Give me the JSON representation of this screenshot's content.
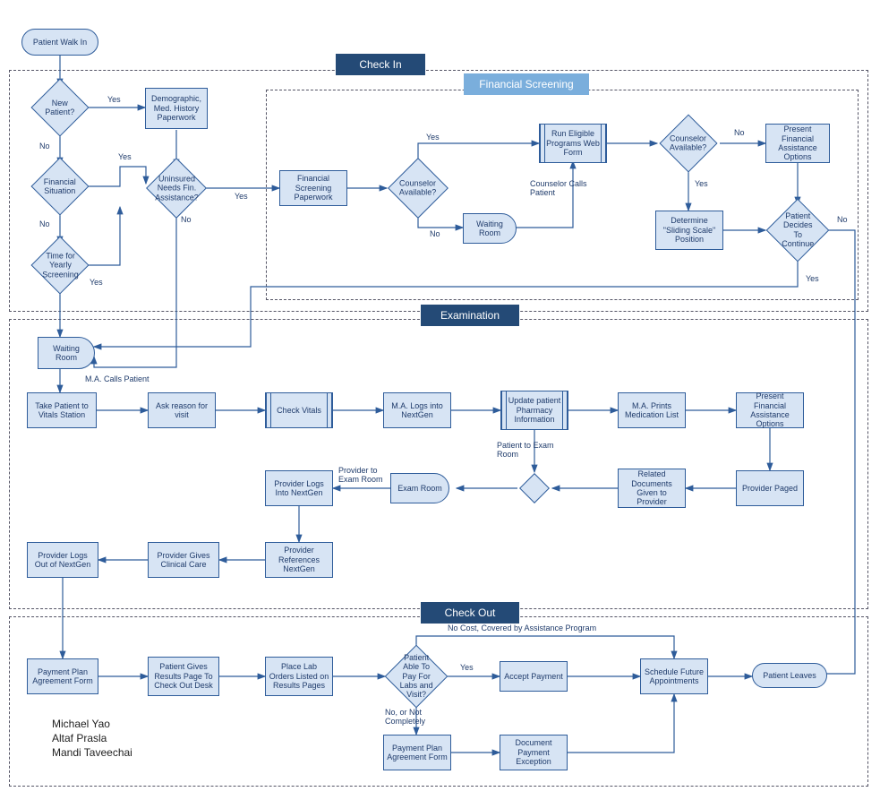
{
  "sections": {
    "checkin": "Check In",
    "financial": "Financial Screening",
    "exam": "Examination",
    "checkout": "Check Out"
  },
  "nodes": {
    "walkin": "Patient Walk In",
    "newPatient": "New Patient?",
    "demographic": "Demographic, Med. History Paperwork",
    "finSituation": "Financial Situation",
    "uninsured": "Uninsured Needs Fin. Assistance?",
    "timeYearly": "Time for Yearly Screening",
    "finScreenPaper": "Financial Screening Paperwork",
    "counselor1": "Counselor Available?",
    "waitingRoom1": "Waiting Room",
    "runEligible": "Run Eligible Programs Web Form",
    "counselor2": "Counselor Available?",
    "determineSliding": "Determine \"Sliding Scale\" Position",
    "presentFinOpts": "Present Financial Assistance Options",
    "patientDecides": "Patient Decides To Continue",
    "waitingRoom2": "Waiting Room",
    "takeVitals": "Take Patient to Vitals Station",
    "askReason": "Ask reason for visit",
    "checkVitals": "Check Vitals",
    "maLogs": "M.A. Logs into NextGen",
    "updatePharm": "Update patient Pharmacy Information",
    "maPrints": "M.A. Prints Medication List",
    "presentFin2": "Present Financial Assistance Options",
    "providerPaged": "Provider Paged",
    "relatedDocs": "Related Documents Given to Provider",
    "examRoomDiamond": "",
    "examRoomDelay": "Exam Room",
    "providerLogsIn": "Provider Logs Into NextGen",
    "providerRefs": "Provider References NextGen",
    "providerGives": "Provider Gives Clinical Care",
    "providerLogsOut": "Provider Logs Out of NextGen",
    "paymentPlan1": "Payment Plan Agreement Form",
    "patientGivesResults": "Patient Gives Results Page To Check Out Desk",
    "placeLabOrders": "Place Lab Orders Listed on Results Pages",
    "patientAblePay": "Patient Able To Pay For Labs and Visit?",
    "acceptPayment": "Accept Payment",
    "scheduleFuture": "Schedule Future Appointments",
    "patientLeaves": "Patient Leaves",
    "paymentPlan2": "Payment Plan Agreement Form",
    "docPaymentExc": "Document Payment Exception"
  },
  "labels": {
    "yes": "Yes",
    "no": "No",
    "counselorCalls": "Counselor Calls Patient",
    "maCalls": "M.A. Calls Patient",
    "patientToExam": "Patient to Exam Room",
    "providerToExam": "Provider to Exam Room",
    "noCost": "No Cost, Covered by Assistance Program",
    "noOrNot": "No, or Not Completely"
  },
  "authors": [
    "Michael Yao",
    "Altaf Prasla",
    "Mandi Taveechai"
  ],
  "chart_data": {
    "type": "flowchart",
    "title": "Patient Visit Workflow",
    "lanes": [
      "Check In",
      "Financial Screening",
      "Examination",
      "Check Out"
    ],
    "nodes": [
      {
        "id": "walkin",
        "type": "terminator",
        "label": "Patient Walk In",
        "lane": "Check In"
      },
      {
        "id": "newPatient",
        "type": "decision",
        "label": "New Patient?",
        "lane": "Check In"
      },
      {
        "id": "demographic",
        "type": "process",
        "label": "Demographic, Med. History Paperwork",
        "lane": "Check In"
      },
      {
        "id": "finSituation",
        "type": "decision",
        "label": "Financial Situation",
        "lane": "Check In"
      },
      {
        "id": "uninsured",
        "type": "decision",
        "label": "Uninsured Needs Fin. Assistance?",
        "lane": "Check In"
      },
      {
        "id": "timeYearly",
        "type": "decision",
        "label": "Time for Yearly Screening",
        "lane": "Check In"
      },
      {
        "id": "finScreenPaper",
        "type": "process",
        "label": "Financial Screening Paperwork",
        "lane": "Financial Screening"
      },
      {
        "id": "counselor1",
        "type": "decision",
        "label": "Counselor Available?",
        "lane": "Financial Screening"
      },
      {
        "id": "waitingRoom1",
        "type": "delay",
        "label": "Waiting Room",
        "lane": "Financial Screening"
      },
      {
        "id": "runEligible",
        "type": "predefined",
        "label": "Run Eligible Programs Web Form",
        "lane": "Financial Screening"
      },
      {
        "id": "counselor2",
        "type": "decision",
        "label": "Counselor Available?",
        "lane": "Financial Screening"
      },
      {
        "id": "determineSliding",
        "type": "process",
        "label": "Determine \"Sliding Scale\" Position",
        "lane": "Financial Screening"
      },
      {
        "id": "presentFinOpts",
        "type": "process",
        "label": "Present Financial Assistance Options",
        "lane": "Financial Screening"
      },
      {
        "id": "patientDecides",
        "type": "decision",
        "label": "Patient Decides To Continue",
        "lane": "Financial Screening"
      },
      {
        "id": "waitingRoom2",
        "type": "delay",
        "label": "Waiting Room",
        "lane": "Examination"
      },
      {
        "id": "takeVitals",
        "type": "process",
        "label": "Take Patient to Vitals Station",
        "lane": "Examination"
      },
      {
        "id": "askReason",
        "type": "process",
        "label": "Ask reason for visit",
        "lane": "Examination"
      },
      {
        "id": "checkVitals",
        "type": "predefined",
        "label": "Check Vitals",
        "lane": "Examination"
      },
      {
        "id": "maLogs",
        "type": "process",
        "label": "M.A. Logs into NextGen",
        "lane": "Examination"
      },
      {
        "id": "updatePharm",
        "type": "predefined",
        "label": "Update patient Pharmacy Information",
        "lane": "Examination"
      },
      {
        "id": "maPrints",
        "type": "process",
        "label": "M.A. Prints Medication List",
        "lane": "Examination"
      },
      {
        "id": "presentFin2",
        "type": "process",
        "label": "Present Financial Assistance Options",
        "lane": "Examination"
      },
      {
        "id": "providerPaged",
        "type": "process",
        "label": "Provider Paged",
        "lane": "Examination"
      },
      {
        "id": "relatedDocs",
        "type": "process",
        "label": "Related Documents Given to Provider",
        "lane": "Examination"
      },
      {
        "id": "examRoomDiamond",
        "type": "decision",
        "label": "",
        "lane": "Examination"
      },
      {
        "id": "examRoomDelay",
        "type": "delay",
        "label": "Exam Room",
        "lane": "Examination"
      },
      {
        "id": "providerLogsIn",
        "type": "process",
        "label": "Provider Logs Into NextGen",
        "lane": "Examination"
      },
      {
        "id": "providerRefs",
        "type": "process",
        "label": "Provider References NextGen",
        "lane": "Examination"
      },
      {
        "id": "providerGives",
        "type": "process",
        "label": "Provider Gives Clinical Care",
        "lane": "Examination"
      },
      {
        "id": "providerLogsOut",
        "type": "process",
        "label": "Provider Logs Out of NextGen",
        "lane": "Examination"
      },
      {
        "id": "paymentPlan1",
        "type": "process",
        "label": "Payment Plan Agreement Form",
        "lane": "Check Out"
      },
      {
        "id": "patientGivesResults",
        "type": "process",
        "label": "Patient Gives Results Page To Check Out Desk",
        "lane": "Check Out"
      },
      {
        "id": "placeLabOrders",
        "type": "process",
        "label": "Place Lab Orders Listed on Results Pages",
        "lane": "Check Out"
      },
      {
        "id": "patientAblePay",
        "type": "decision",
        "label": "Patient Able To Pay For Labs and Visit?",
        "lane": "Check Out"
      },
      {
        "id": "acceptPayment",
        "type": "process",
        "label": "Accept Payment",
        "lane": "Check Out"
      },
      {
        "id": "scheduleFuture",
        "type": "process",
        "label": "Schedule Future Appointments",
        "lane": "Check Out"
      },
      {
        "id": "patientLeaves",
        "type": "terminator",
        "label": "Patient Leaves",
        "lane": "Check Out"
      },
      {
        "id": "paymentPlan2",
        "type": "process",
        "label": "Payment Plan Agreement Form",
        "lane": "Check Out"
      },
      {
        "id": "docPaymentExc",
        "type": "process",
        "label": "Document Payment Exception",
        "lane": "Check Out"
      }
    ],
    "edges": [
      {
        "from": "walkin",
        "to": "newPatient"
      },
      {
        "from": "newPatient",
        "to": "demographic",
        "label": "Yes"
      },
      {
        "from": "newPatient",
        "to": "finSituation",
        "label": "No"
      },
      {
        "from": "demographic",
        "to": "uninsured"
      },
      {
        "from": "finSituation",
        "to": "uninsured",
        "label": "Yes"
      },
      {
        "from": "finSituation",
        "to": "timeYearly",
        "label": "No"
      },
      {
        "from": "timeYearly",
        "to": "uninsured",
        "label": "Yes"
      },
      {
        "from": "timeYearly",
        "to": "waitingRoom2"
      },
      {
        "from": "uninsured",
        "to": "finScreenPaper",
        "label": "Yes"
      },
      {
        "from": "uninsured",
        "to": "waitingRoom2",
        "label": "No"
      },
      {
        "from": "finScreenPaper",
        "to": "counselor1"
      },
      {
        "from": "counselor1",
        "to": "runEligible",
        "label": "Yes"
      },
      {
        "from": "counselor1",
        "to": "waitingRoom1",
        "label": "No"
      },
      {
        "from": "waitingRoom1",
        "to": "runEligible",
        "label": "Counselor Calls Patient"
      },
      {
        "from": "runEligible",
        "to": "counselor2"
      },
      {
        "from": "counselor2",
        "to": "determineSliding",
        "label": "Yes"
      },
      {
        "from": "counselor2",
        "to": "presentFinOpts",
        "label": "No"
      },
      {
        "from": "determineSliding",
        "to": "patientDecides"
      },
      {
        "from": "presentFinOpts",
        "to": "patientDecides"
      },
      {
        "from": "patientDecides",
        "to": "waitingRoom2",
        "label": "Yes"
      },
      {
        "from": "patientDecides",
        "to": "patientLeaves",
        "label": "No"
      },
      {
        "from": "waitingRoom2",
        "to": "takeVitals",
        "label": "M.A. Calls Patient"
      },
      {
        "from": "takeVitals",
        "to": "askReason"
      },
      {
        "from": "askReason",
        "to": "checkVitals"
      },
      {
        "from": "checkVitals",
        "to": "maLogs"
      },
      {
        "from": "maLogs",
        "to": "updatePharm"
      },
      {
        "from": "updatePharm",
        "to": "maPrints"
      },
      {
        "from": "maPrints",
        "to": "presentFin2"
      },
      {
        "from": "presentFin2",
        "to": "providerPaged"
      },
      {
        "from": "providerPaged",
        "to": "relatedDocs"
      },
      {
        "from": "relatedDocs",
        "to": "examRoomDiamond"
      },
      {
        "from": "updatePharm",
        "to": "examRoomDiamond",
        "label": "Patient to Exam Room"
      },
      {
        "from": "examRoomDiamond",
        "to": "examRoomDelay"
      },
      {
        "from": "examRoomDelay",
        "to": "providerLogsIn",
        "label": "Provider to Exam Room"
      },
      {
        "from": "providerLogsIn",
        "to": "providerRefs"
      },
      {
        "from": "providerRefs",
        "to": "providerGives"
      },
      {
        "from": "providerGives",
        "to": "providerLogsOut"
      },
      {
        "from": "providerLogsOut",
        "to": "paymentPlan1"
      },
      {
        "from": "paymentPlan1",
        "to": "patientGivesResults"
      },
      {
        "from": "patientGivesResults",
        "to": "placeLabOrders"
      },
      {
        "from": "placeLabOrders",
        "to": "patientAblePay"
      },
      {
        "from": "patientAblePay",
        "to": "acceptPayment",
        "label": "Yes"
      },
      {
        "from": "patientAblePay",
        "to": "paymentPlan2",
        "label": "No, or Not Completely"
      },
      {
        "from": "patientAblePay",
        "to": "scheduleFuture",
        "label": "No Cost, Covered by Assistance Program"
      },
      {
        "from": "acceptPayment",
        "to": "scheduleFuture"
      },
      {
        "from": "paymentPlan2",
        "to": "docPaymentExc"
      },
      {
        "from": "docPaymentExc",
        "to": "scheduleFuture"
      },
      {
        "from": "scheduleFuture",
        "to": "patientLeaves"
      }
    ]
  }
}
